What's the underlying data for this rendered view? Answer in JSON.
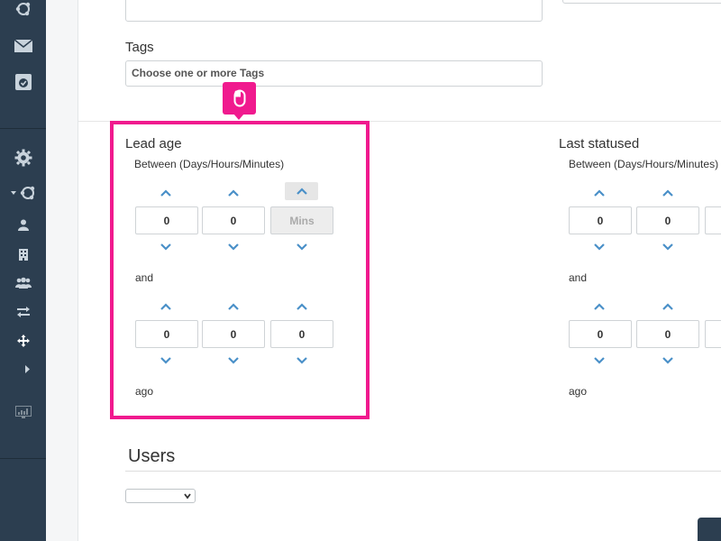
{
  "sidebar": {
    "icons": [
      "hub-icon",
      "mail-icon",
      "task-icon",
      "gear-icon",
      "hub-dropdown-icon",
      "user-icon",
      "building-icon",
      "group-icon",
      "transfer-icon",
      "move-icon",
      "share-icon",
      "monitor-chart-icon"
    ]
  },
  "tags": {
    "label": "Tags",
    "placeholder": "Choose one or more Tags"
  },
  "lead_age": {
    "title": "Lead age",
    "between_label": "Between (Days/Hours/Minutes)",
    "from": {
      "days": "0",
      "hours": "0",
      "minutes_placeholder": "Mins"
    },
    "and_label": "and",
    "to": {
      "days": "0",
      "hours": "0",
      "minutes": "0"
    },
    "ago_label": "ago"
  },
  "last_statused": {
    "title": "Last statused",
    "between_label": "Between (Days/Hours/Minutes)",
    "from": {
      "days": "0",
      "hours": "0"
    },
    "and_label": "and",
    "to": {
      "days": "0",
      "hours": "0"
    },
    "ago_label": "ago"
  },
  "users": {
    "title": "Users",
    "selected": ""
  },
  "colors": {
    "sidebar": "#2c3e50",
    "highlight": "#f01a8e",
    "spinner_arrow": "#4a90c8"
  }
}
